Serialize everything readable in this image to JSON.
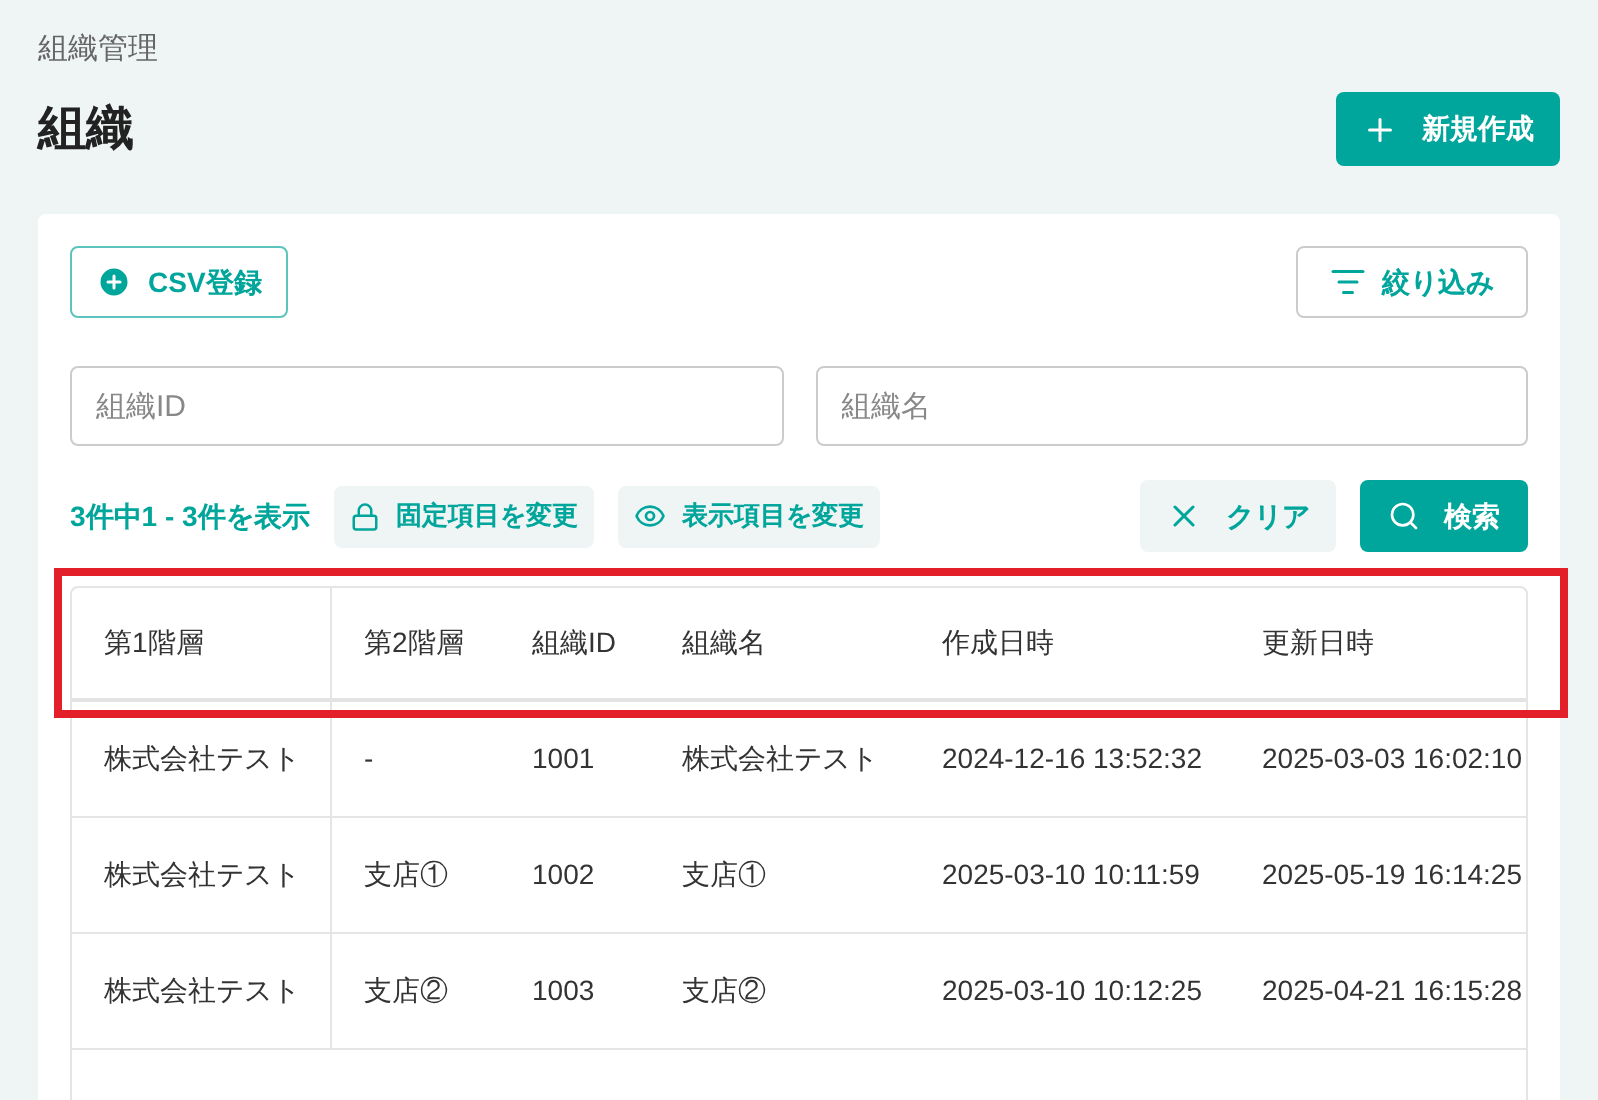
{
  "breadcrumb": "組織管理",
  "title": "組織",
  "create_button": "新規作成",
  "csv_button": "CSV登録",
  "filter_button": "絞り込み",
  "fields": [
    {
      "placeholder": "組織ID"
    },
    {
      "placeholder": "組織名"
    }
  ],
  "result_count": "3件中1 - 3件を表示",
  "fixed_columns_button": "固定項目を変更",
  "visible_columns_button": "表示項目を変更",
  "clear_button": "クリア",
  "search_button": "検索",
  "table": {
    "columns": [
      "第1階層",
      "第2階層",
      "組織ID",
      "組織名",
      "作成日時",
      "更新日時"
    ],
    "rows": [
      [
        "株式会社テスト",
        "-",
        "1001",
        "株式会社テスト",
        "2024-12-16 13:52:32",
        "2025-03-03 16:02:10"
      ],
      [
        "株式会社テスト",
        "支店①",
        "1002",
        "支店①",
        "2025-03-10 10:11:59",
        "2025-05-19 16:14:25"
      ],
      [
        "株式会社テスト",
        "支店②",
        "1003",
        "支店②",
        "2025-03-10 10:12:25",
        "2025-04-21 16:15:28"
      ]
    ]
  }
}
